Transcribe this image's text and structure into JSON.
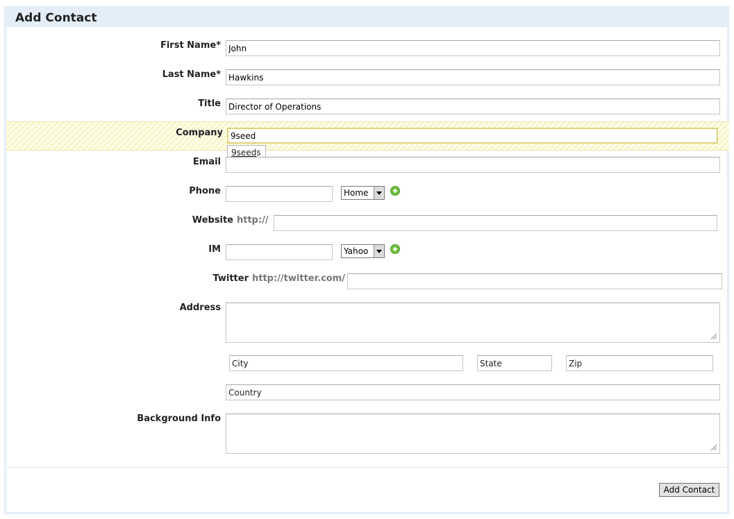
{
  "form": {
    "title": "Add Contact",
    "first_name": {
      "label": "First Name*",
      "value": "John"
    },
    "last_name": {
      "label": "Last Name*",
      "value": "Hawkins"
    },
    "title_field": {
      "label": "Title",
      "value": "Director of Operations"
    },
    "company": {
      "label": "Company",
      "value": "9seed",
      "suggestion_match": "9seed",
      "suggestion_rest": "s"
    },
    "email": {
      "label": "Email",
      "value": ""
    },
    "phone": {
      "label": "Phone",
      "value": "",
      "type_selected": "Home"
    },
    "website": {
      "label": "Website",
      "prefix": "http://",
      "value": ""
    },
    "im": {
      "label": "IM",
      "value": "",
      "type_selected": "Yahoo"
    },
    "twitter": {
      "label": "Twitter",
      "prefix": "http://twitter.com/",
      "value": ""
    },
    "address": {
      "label": "Address",
      "value": ""
    },
    "city": {
      "placeholder": "City"
    },
    "state": {
      "placeholder": "State"
    },
    "zip": {
      "placeholder": "Zip"
    },
    "country": {
      "placeholder": "Country"
    },
    "background": {
      "label": "Background Info",
      "value": ""
    },
    "submit_label": "Add Contact"
  },
  "icons": {
    "add": "add-circle-icon",
    "resize": "resize-grip-icon",
    "dropdown": "chevron-down-icon"
  },
  "colors": {
    "header_bg": "#e3eef8",
    "highlight_bg": "#fdf8d6",
    "add_icon": "#6fbf3f"
  }
}
